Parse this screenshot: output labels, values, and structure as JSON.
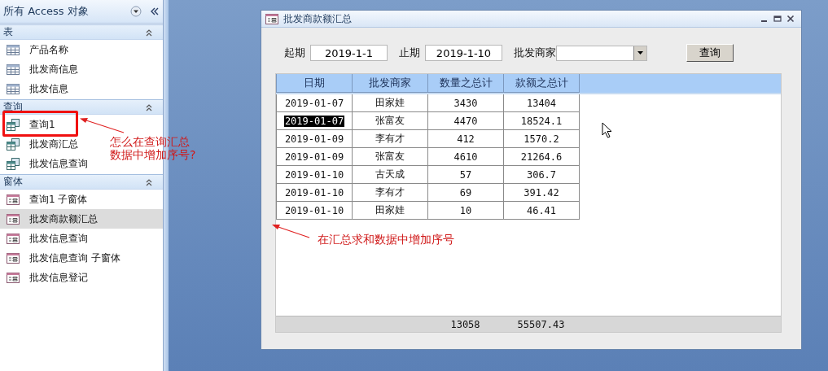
{
  "nav": {
    "title": "所有 Access 对象",
    "groups": [
      {
        "label": "表",
        "kind": "table",
        "items": [
          {
            "label": "产品名称",
            "selected": false
          },
          {
            "label": "批发商信息",
            "selected": false
          },
          {
            "label": "批发信息",
            "selected": false
          }
        ]
      },
      {
        "label": "查询",
        "kind": "query",
        "items": [
          {
            "label": "查询1",
            "selected": false
          },
          {
            "label": "批发商汇总",
            "selected": false
          },
          {
            "label": "批发信息查询",
            "selected": false
          }
        ]
      },
      {
        "label": "窗体",
        "kind": "form",
        "items": [
          {
            "label": "查询1 子窗体",
            "selected": false
          },
          {
            "label": "批发商款额汇总",
            "selected": true
          },
          {
            "label": "批发信息查询",
            "selected": false
          },
          {
            "label": "批发信息查询 子窗体",
            "selected": false
          },
          {
            "label": "批发信息登记",
            "selected": false
          }
        ]
      }
    ]
  },
  "form": {
    "title": "批发商款额汇总",
    "filters": {
      "start_label": "起期",
      "start_value": "2019-1-1",
      "end_label": "止期",
      "end_value": "2019-1-10",
      "dealer_label": "批发商家"
    },
    "query_button": "查询",
    "table": {
      "columns": [
        "日期",
        "批发商家",
        "数量之总计",
        "款额之总计"
      ],
      "rows": [
        {
          "cells": [
            "2019-01-07",
            "田家娃",
            "3430",
            "13404"
          ],
          "selected": false
        },
        {
          "cells": [
            "2019-01-07",
            "张富友",
            "4470",
            "18524.1"
          ],
          "selected": true
        },
        {
          "cells": [
            "2019-01-09",
            "李有才",
            "412",
            "1570.2"
          ],
          "selected": false
        },
        {
          "cells": [
            "2019-01-09",
            "张富友",
            "4610",
            "21264.6"
          ],
          "selected": false
        },
        {
          "cells": [
            "2019-01-10",
            "古天成",
            "57",
            "306.7"
          ],
          "selected": false
        },
        {
          "cells": [
            "2019-01-10",
            "李有才",
            "69",
            "391.42"
          ],
          "selected": false
        },
        {
          "cells": [
            "2019-01-10",
            "田家娃",
            "10",
            "46.41"
          ],
          "selected": false
        }
      ],
      "totals": [
        "13058",
        "55507.43"
      ]
    }
  },
  "annotations": {
    "question_lines": [
      "怎么在查询汇总",
      "数据中增加序号?"
    ],
    "note": "在汇总求和数据中增加序号"
  }
}
